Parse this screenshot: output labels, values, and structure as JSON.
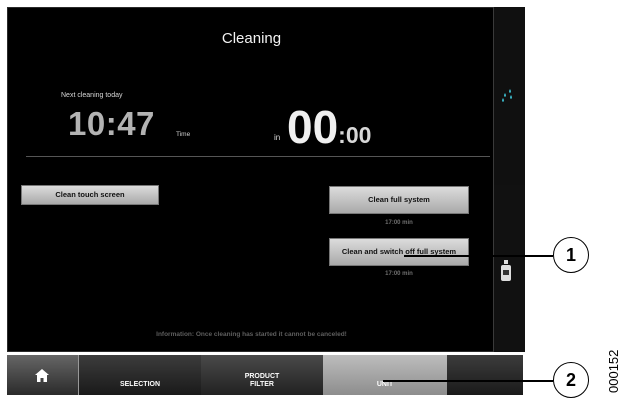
{
  "screen": {
    "title": "Cleaning",
    "next_cleaning_label": "Next cleaning today",
    "next_cleaning_time": "10:47",
    "time_unit": "Time",
    "countdown_prefix": "in",
    "countdown_minutes": "00",
    "countdown_seconds": ":00",
    "info_text": "Information: Once cleaning has started it cannot be canceled!"
  },
  "buttons": {
    "clean_touch_screen": "Clean touch screen",
    "clean_full_system": "Clean full system",
    "clean_full_system_duration": "17:00 min",
    "clean_and_switch_off": "Clean and switch off full system",
    "clean_and_switch_off_duration": "17:00 min"
  },
  "tabs": {
    "selection": "SELECTION",
    "product_filter_line1": "PRODUCT",
    "product_filter_line2": "FILTER",
    "unit": "UNIT"
  },
  "callouts": [
    "1",
    "2"
  ],
  "document_number": "000152",
  "icons": [
    "home-icon",
    "water-drops-icon",
    "bottle-icon"
  ],
  "colors": {
    "screen_bg": "#000000",
    "button_bg": "#c8c8c8",
    "active_tab": "#a8a8a8"
  }
}
